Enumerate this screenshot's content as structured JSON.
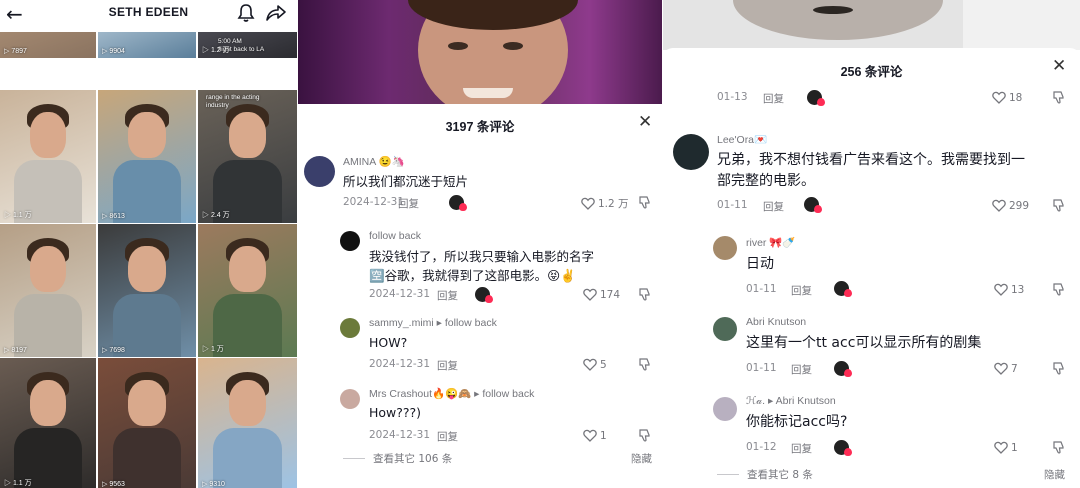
{
  "profile": {
    "username": "SETH EDEEN",
    "icons": {
      "back": "back-arrow-icon",
      "bell": "bell-icon",
      "share": "share-icon",
      "grid": "grid-view-icon"
    },
    "tiles": [
      {
        "views": "7897",
        "caption": ""
      },
      {
        "views": "9904",
        "caption": ""
      },
      {
        "views": "1.2 万",
        "caption": "5:00 AM\nflight back to LA"
      },
      {
        "views": "1.1 万",
        "caption": ""
      },
      {
        "views": "8613",
        "caption": ""
      },
      {
        "views": "2.4 万",
        "caption": "range in the acting\nindustry"
      },
      {
        "views": "8197",
        "caption": ""
      },
      {
        "views": "7698",
        "caption": ""
      },
      {
        "views": "1 万",
        "caption": ""
      },
      {
        "views": "1.1 万",
        "caption": ""
      },
      {
        "views": "9563",
        "caption": ""
      },
      {
        "views": "9310",
        "caption": ""
      }
    ]
  },
  "comments_a": {
    "title": "3197 条评论",
    "reply_label": "回复",
    "comments": [
      {
        "user": "AMINA 😉🦄",
        "text": "所以我们都沉迷于短片",
        "date": "2024-12-31",
        "likes": "1.2 万"
      },
      {
        "user": "follow back",
        "text": "我没钱付了，所以我只要输入电影的名字🈳谷歌，我就得到了这部电影。😝✌️",
        "date": "2024-12-31",
        "likes": "174"
      },
      {
        "user": "sammy_.mimi",
        "reply_to": "follow back",
        "text": "HOW?",
        "date": "2024-12-31",
        "likes": "5"
      },
      {
        "user": "Mrs Crashout🔥😜🙈",
        "reply_to": "follow back",
        "text": "How???)",
        "date": "2024-12-31",
        "likes": "1"
      }
    ],
    "view_more": "查看其它 106 条",
    "hide": "隐藏"
  },
  "comments_b": {
    "title": "256 条评论",
    "reply_label": "回复",
    "top_row": {
      "date": "01-13",
      "likes": "18"
    },
    "comments": [
      {
        "user": "Lee'Ora💌",
        "text": "兄弟，我不想付钱看广告来看这个。我需要找到一部完整的电影。",
        "date": "01-11",
        "likes": "299"
      },
      {
        "user": "river 🎀🍼",
        "text": "日动",
        "date": "01-11",
        "likes": "13"
      },
      {
        "user": "Abri Knutson",
        "text": "这里有一个tt acc可以显示所有的剧集",
        "date": "01-11",
        "likes": "7"
      },
      {
        "user": "ℋ𝒶.",
        "reply_to": "Abri Knutson",
        "text": "你能标记acc吗?",
        "date": "01-12",
        "likes": "1"
      }
    ],
    "view_more": "查看其它 8 条",
    "hide": "隐藏"
  },
  "colors": {
    "liked": "#fe2c55",
    "muted": "#75767c",
    "text": "#161823"
  }
}
